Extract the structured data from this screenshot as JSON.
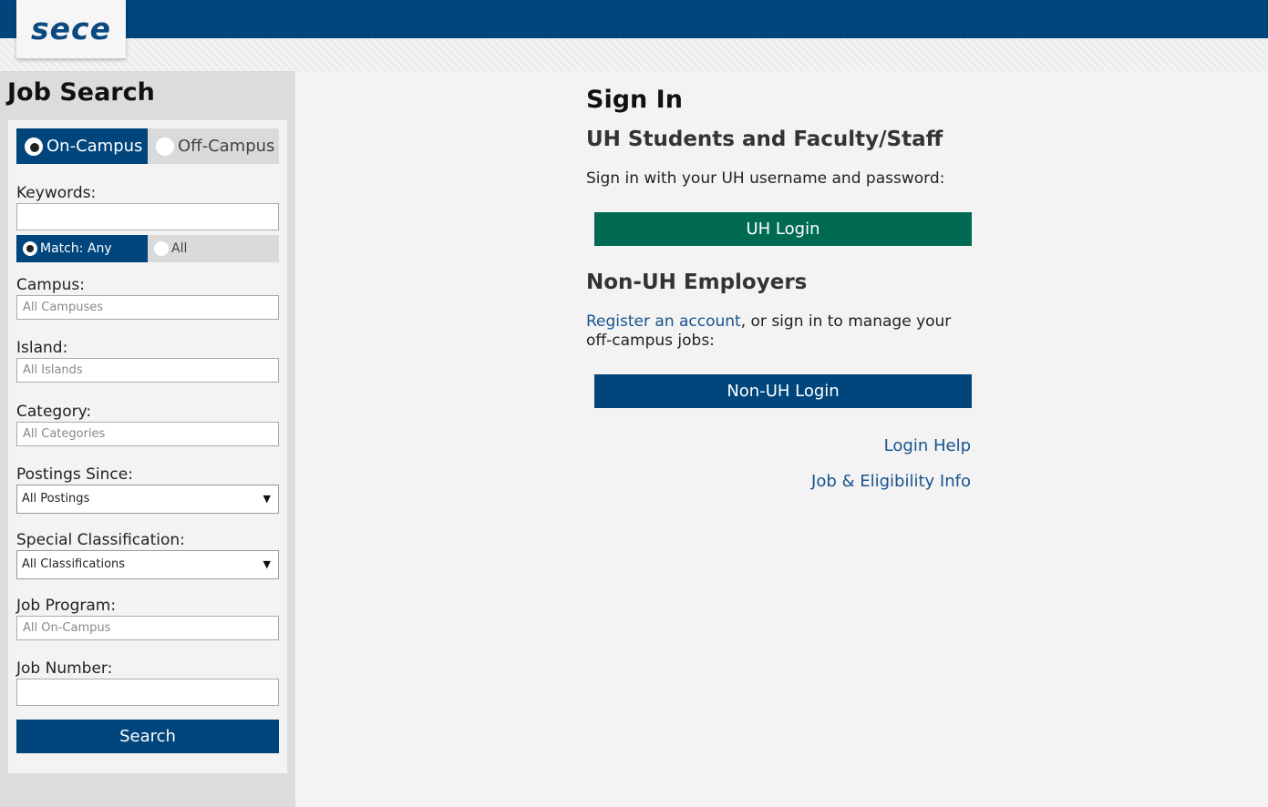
{
  "header": {
    "logo_text": "sece"
  },
  "sidebar": {
    "title": "Job Search",
    "location_toggle": {
      "on_campus": "On-Campus",
      "off_campus": "Off-Campus",
      "selected": "On-Campus"
    },
    "keywords": {
      "label": "Keywords:",
      "value": "",
      "match_any": "Match: Any",
      "match_all": "All",
      "selected": "Match: Any"
    },
    "campus": {
      "label": "Campus:",
      "placeholder": "All Campuses"
    },
    "island": {
      "label": "Island:",
      "placeholder": "All Islands"
    },
    "category": {
      "label": "Category:",
      "placeholder": "All Categories"
    },
    "postings_since": {
      "label": "Postings Since:",
      "value": "All Postings"
    },
    "special_classification": {
      "label": "Special Classification:",
      "value": "All Classifications"
    },
    "job_program": {
      "label": "Job Program:",
      "placeholder": "All On-Campus"
    },
    "job_number": {
      "label": "Job Number:",
      "value": ""
    },
    "search_button": "Search"
  },
  "main": {
    "title": "Sign In",
    "uh_section": {
      "heading": "UH Students and Faculty/Staff",
      "text": "Sign in with your UH username and password:",
      "button": "UH Login"
    },
    "non_uh_section": {
      "heading": "Non-UH Employers",
      "register_link": "Register an account",
      "text_after_link": ", or sign in to manage your off-campus jobs:",
      "button": "Non-UH Login"
    },
    "links": {
      "login_help": "Login Help",
      "job_info": "Job & Eligibility Info"
    }
  },
  "colors": {
    "brand_blue": "#00457c",
    "uh_green": "#006b52",
    "link_blue": "#17548e"
  }
}
